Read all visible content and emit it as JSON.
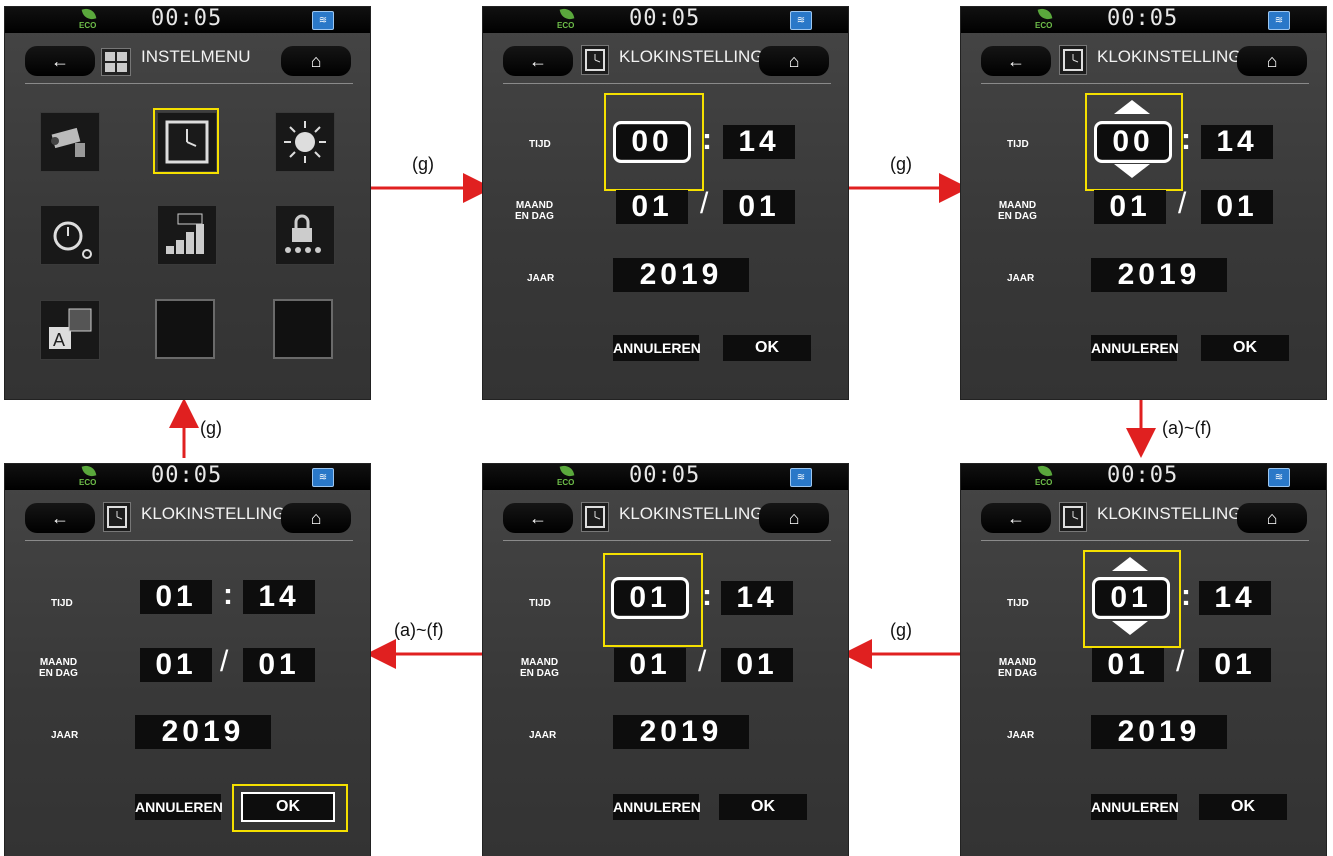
{
  "status": {
    "eco": "ECO",
    "time": "00:05"
  },
  "header": {
    "back_glyph": "←",
    "home_glyph": "⌂"
  },
  "menu_title": "INSTELMENU",
  "clock_title": "KLOKINSTELLING",
  "labels": {
    "time": "TIJD",
    "month_day_1": "MAAND",
    "month_day_2": "EN DAG",
    "year": "JAAR"
  },
  "buttons": {
    "cancel": "ANNULEREN",
    "ok": "OK"
  },
  "arrows": {
    "g": "(g)",
    "af": "(a)~(f)"
  },
  "menu_icons": [
    "camera-icon",
    "clock-icon",
    "brightness-icon",
    "timer-icon",
    "volume-icon",
    "lock-icon",
    "language-icon"
  ],
  "screens": {
    "s2": {
      "hour": "00",
      "minute": "14",
      "month": "01",
      "day": "01",
      "year": "2019"
    },
    "s3": {
      "hour": "00",
      "minute": "14",
      "month": "01",
      "day": "01",
      "year": "2019"
    },
    "s4": {
      "hour": "01",
      "minute": "14",
      "month": "01",
      "day": "01",
      "year": "2019"
    },
    "s5": {
      "hour": "01",
      "minute": "14",
      "month": "01",
      "day": "01",
      "year": "2019"
    },
    "s6": {
      "hour": "01",
      "minute": "14",
      "month": "01",
      "day": "01",
      "year": "2019"
    }
  },
  "colors": {
    "highlight": "#f5e000",
    "arrow": "#e02020",
    "screen": "#3a3a3a"
  }
}
